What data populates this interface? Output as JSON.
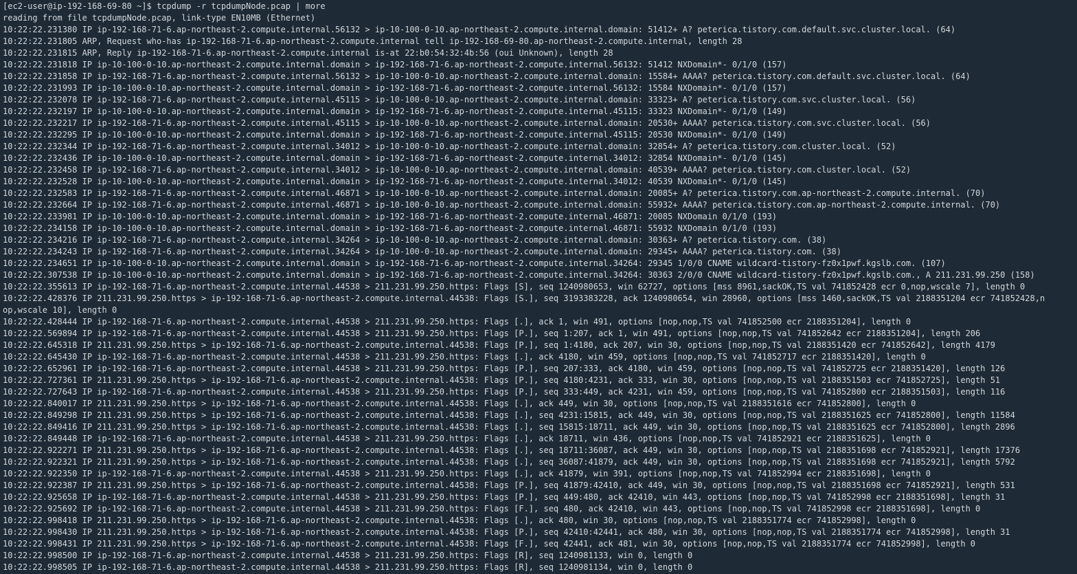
{
  "terminal": {
    "lines": [
      "[ec2-user@ip-192-168-69-80 ~]$ tcpdump -r tcpdumpNode.pcap | more",
      "reading from file tcpdumpNode.pcap, link-type EN10MB (Ethernet)",
      "10:22:22.231380 IP ip-192-168-71-6.ap-northeast-2.compute.internal.56132 > ip-10-100-0-10.ap-northeast-2.compute.internal.domain: 51412+ A? peterica.tistory.com.default.svc.cluster.local. (64)",
      "10:22:22.231805 ARP, Request who-has ip-192-168-71-6.ap-northeast-2.compute.internal tell ip-192-168-69-80.ap-northeast-2.compute.internal, length 28",
      "10:22:22.231815 ARP, Reply ip-192-168-71-6.ap-northeast-2.compute.internal is-at 22:b0:54:32:4b:56 (oui Unknown), length 28",
      "10:22:22.231818 IP ip-10-100-0-10.ap-northeast-2.compute.internal.domain > ip-192-168-71-6.ap-northeast-2.compute.internal.56132: 51412 NXDomain*- 0/1/0 (157)",
      "10:22:22.231858 IP ip-192-168-71-6.ap-northeast-2.compute.internal.56132 > ip-10-100-0-10.ap-northeast-2.compute.internal.domain: 15584+ AAAA? peterica.tistory.com.default.svc.cluster.local. (64)",
      "10:22:22.231993 IP ip-10-100-0-10.ap-northeast-2.compute.internal.domain > ip-192-168-71-6.ap-northeast-2.compute.internal.56132: 15584 NXDomain*- 0/1/0 (157)",
      "10:22:22.232078 IP ip-192-168-71-6.ap-northeast-2.compute.internal.45115 > ip-10-100-0-10.ap-northeast-2.compute.internal.domain: 33323+ A? peterica.tistory.com.svc.cluster.local. (56)",
      "10:22:22.232197 IP ip-10-100-0-10.ap-northeast-2.compute.internal.domain > ip-192-168-71-6.ap-northeast-2.compute.internal.45115: 33323 NXDomain*- 0/1/0 (149)",
      "10:22:22.232217 IP ip-192-168-71-6.ap-northeast-2.compute.internal.45115 > ip-10-100-0-10.ap-northeast-2.compute.internal.domain: 20530+ AAAA? peterica.tistory.com.svc.cluster.local. (56)",
      "10:22:22.232295 IP ip-10-100-0-10.ap-northeast-2.compute.internal.domain > ip-192-168-71-6.ap-northeast-2.compute.internal.45115: 20530 NXDomain*- 0/1/0 (149)",
      "10:22:22.232344 IP ip-192-168-71-6.ap-northeast-2.compute.internal.34012 > ip-10-100-0-10.ap-northeast-2.compute.internal.domain: 32854+ A? peterica.tistory.com.cluster.local. (52)",
      "10:22:22.232436 IP ip-10-100-0-10.ap-northeast-2.compute.internal.domain > ip-192-168-71-6.ap-northeast-2.compute.internal.34012: 32854 NXDomain*- 0/1/0 (145)",
      "10:22:22.232458 IP ip-192-168-71-6.ap-northeast-2.compute.internal.34012 > ip-10-100-0-10.ap-northeast-2.compute.internal.domain: 40539+ AAAA? peterica.tistory.com.cluster.local. (52)",
      "10:22:22.232528 IP ip-10-100-0-10.ap-northeast-2.compute.internal.domain > ip-192-168-71-6.ap-northeast-2.compute.internal.34012: 40539 NXDomain*- 0/1/0 (145)",
      "10:22:22.232583 IP ip-192-168-71-6.ap-northeast-2.compute.internal.46871 > ip-10-100-0-10.ap-northeast-2.compute.internal.domain: 20085+ A? peterica.tistory.com.ap-northeast-2.compute.internal. (70)",
      "10:22:22.232664 IP ip-192-168-71-6.ap-northeast-2.compute.internal.46871 > ip-10-100-0-10.ap-northeast-2.compute.internal.domain: 55932+ AAAA? peterica.tistory.com.ap-northeast-2.compute.internal. (70)",
      "10:22:22.233981 IP ip-10-100-0-10.ap-northeast-2.compute.internal.domain > ip-192-168-71-6.ap-northeast-2.compute.internal.46871: 20085 NXDomain 0/1/0 (193)",
      "10:22:22.234158 IP ip-10-100-0-10.ap-northeast-2.compute.internal.domain > ip-192-168-71-6.ap-northeast-2.compute.internal.46871: 55932 NXDomain 0/1/0 (193)",
      "10:22:22.234216 IP ip-192-168-71-6.ap-northeast-2.compute.internal.34264 > ip-10-100-0-10.ap-northeast-2.compute.internal.domain: 30363+ A? peterica.tistory.com. (38)",
      "10:22:22.234243 IP ip-192-168-71-6.ap-northeast-2.compute.internal.34264 > ip-10-100-0-10.ap-northeast-2.compute.internal.domain: 29345+ AAAA? peterica.tistory.com. (38)",
      "10:22:22.234651 IP ip-10-100-0-10.ap-northeast-2.compute.internal.domain > ip-192-168-71-6.ap-northeast-2.compute.internal.34264: 29345 1/0/0 CNAME wildcard-tistory-fz0x1pwf.kgslb.com. (107)",
      "10:22:22.307538 IP ip-10-100-0-10.ap-northeast-2.compute.internal.domain > ip-192-168-71-6.ap-northeast-2.compute.internal.34264: 30363 2/0/0 CNAME wildcard-tistory-fz0x1pwf.kgslb.com., A 211.231.99.250 (158)",
      "10:22:22.355613 IP ip-192-168-71-6.ap-northeast-2.compute.internal.44538 > 211.231.99.250.https: Flags [S], seq 1240980653, win 62727, options [mss 8961,sackOK,TS val 741852428 ecr 0,nop,wscale 7], length 0",
      "10:22:22.428376 IP 211.231.99.250.https > ip-192-168-71-6.ap-northeast-2.compute.internal.44538: Flags [S.], seq 3193383228, ack 1240980654, win 28960, options [mss 1460,sackOK,TS val 2188351204 ecr 741852428,n",
      "op,wscale 10], length 0",
      "10:22:22.428444 IP ip-192-168-71-6.ap-northeast-2.compute.internal.44538 > 211.231.99.250.https: Flags [.], ack 1, win 491, options [nop,nop,TS val 741852500 ecr 2188351204], length 0",
      "10:22:22.569894 IP ip-192-168-71-6.ap-northeast-2.compute.internal.44538 > 211.231.99.250.https: Flags [P.], seq 1:207, ack 1, win 491, options [nop,nop,TS val 741852642 ecr 2188351204], length 206",
      "10:22:22.645318 IP 211.231.99.250.https > ip-192-168-71-6.ap-northeast-2.compute.internal.44538: Flags [P.], seq 1:4180, ack 207, win 30, options [nop,nop,TS val 2188351420 ecr 741852642], length 4179",
      "10:22:22.645430 IP ip-192-168-71-6.ap-northeast-2.compute.internal.44538 > 211.231.99.250.https: Flags [.], ack 4180, win 459, options [nop,nop,TS val 741852717 ecr 2188351420], length 0",
      "10:22:22.652961 IP ip-192-168-71-6.ap-northeast-2.compute.internal.44538 > 211.231.99.250.https: Flags [P.], seq 207:333, ack 4180, win 459, options [nop,nop,TS val 741852725 ecr 2188351420], length 126",
      "10:22:22.727361 IP 211.231.99.250.https > ip-192-168-71-6.ap-northeast-2.compute.internal.44538: Flags [P.], seq 4180:4231, ack 333, win 30, options [nop,nop,TS val 2188351503 ecr 741852725], length 51",
      "10:22:22.727643 IP ip-192-168-71-6.ap-northeast-2.compute.internal.44538 > 211.231.99.250.https: Flags [P.], seq 333:449, ack 4231, win 459, options [nop,nop,TS val 741852800 ecr 2188351503], length 116",
      "10:22:22.840017 IP 211.231.99.250.https > ip-192-168-71-6.ap-northeast-2.compute.internal.44538: Flags [.], ack 449, win 30, options [nop,nop,TS val 2188351616 ecr 741852800], length 0",
      "10:22:22.849298 IP 211.231.99.250.https > ip-192-168-71-6.ap-northeast-2.compute.internal.44538: Flags [.], seq 4231:15815, ack 449, win 30, options [nop,nop,TS val 2188351625 ecr 741852800], length 11584",
      "10:22:22.849416 IP 211.231.99.250.https > ip-192-168-71-6.ap-northeast-2.compute.internal.44538: Flags [.], seq 15815:18711, ack 449, win 30, options [nop,nop,TS val 2188351625 ecr 741852800], length 2896",
      "10:22:22.849448 IP ip-192-168-71-6.ap-northeast-2.compute.internal.44538 > 211.231.99.250.https: Flags [.], ack 18711, win 436, options [nop,nop,TS val 741852921 ecr 2188351625], length 0",
      "10:22:22.922271 IP 211.231.99.250.https > ip-192-168-71-6.ap-northeast-2.compute.internal.44538: Flags [.], seq 18711:36087, ack 449, win 30, options [nop,nop,TS val 2188351698 ecr 741852921], length 17376",
      "10:22:22.922321 IP 211.231.99.250.https > ip-192-168-71-6.ap-northeast-2.compute.internal.44538: Flags [.], seq 36087:41879, ack 449, win 30, options [nop,nop,TS val 2188351698 ecr 741852921], length 5792",
      "10:22:22.922350 IP ip-192-168-71-6.ap-northeast-2.compute.internal.44538 > 211.231.99.250.https: Flags [.], ack 41879, win 391, options [nop,nop,TS val 741852994 ecr 2188351698], length 0",
      "10:22:22.922387 IP 211.231.99.250.https > ip-192-168-71-6.ap-northeast-2.compute.internal.44538: Flags [P.], seq 41879:42410, ack 449, win 30, options [nop,nop,TS val 2188351698 ecr 741852921], length 531",
      "10:22:22.925658 IP ip-192-168-71-6.ap-northeast-2.compute.internal.44538 > 211.231.99.250.https: Flags [P.], seq 449:480, ack 42410, win 443, options [nop,nop,TS val 741852998 ecr 2188351698], length 31",
      "10:22:22.925692 IP ip-192-168-71-6.ap-northeast-2.compute.internal.44538 > 211.231.99.250.https: Flags [F.], seq 480, ack 42410, win 443, options [nop,nop,TS val 741852998 ecr 2188351698], length 0",
      "10:22:22.998418 IP 211.231.99.250.https > ip-192-168-71-6.ap-northeast-2.compute.internal.44538: Flags [.], ack 480, win 30, options [nop,nop,TS val 2188351774 ecr 741852998], length 0",
      "10:22:22.998430 IP 211.231.99.250.https > ip-192-168-71-6.ap-northeast-2.compute.internal.44538: Flags [P.], seq 42410:42441, ack 480, win 30, options [nop,nop,TS val 2188351774 ecr 741852998], length 31",
      "10:22:22.998431 IP 211.231.99.250.https > ip-192-168-71-6.ap-northeast-2.compute.internal.44538: Flags [F.], seq 42441, ack 481, win 30, options [nop,nop,TS val 2188351774 ecr 741852998], length 0",
      "10:22:22.998500 IP ip-192-168-71-6.ap-northeast-2.compute.internal.44538 > 211.231.99.250.https: Flags [R], seq 1240981133, win 0, length 0",
      "10:22:22.998505 IP ip-192-168-71-6.ap-northeast-2.compute.internal.44538 > 211.231.99.250.https: Flags [R], seq 1240981134, win 0, length 0"
    ]
  }
}
